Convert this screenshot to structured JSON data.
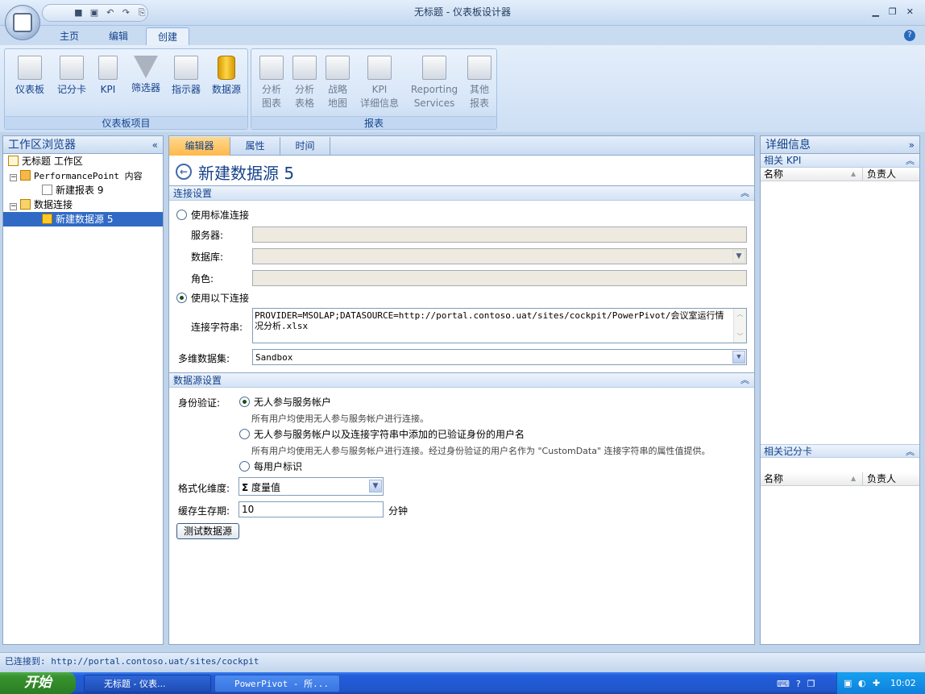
{
  "window": {
    "title": "无标题  -  仪表板设计器"
  },
  "ribbon_tabs": [
    "主页",
    "编辑",
    "创建"
  ],
  "ribbon": {
    "group1": {
      "label": "仪表板项目",
      "buttons": [
        "仪表板",
        "记分卡",
        "KPI",
        "筛选器",
        "指示器",
        "数据源"
      ]
    },
    "group2": {
      "label": "报表",
      "buttons": [
        [
          "分析",
          "图表"
        ],
        [
          "分析",
          "表格"
        ],
        [
          "战略",
          "地图"
        ],
        [
          "KPI",
          "详细信息"
        ],
        [
          "Reporting",
          "Services"
        ],
        [
          "其他",
          "报表"
        ]
      ]
    }
  },
  "left": {
    "title": "工作区浏览器",
    "workspace": "无标题 工作区",
    "ppcontent": "PerformancePoint 内容",
    "report": "新建报表 9",
    "dataconn": "数据连接",
    "datasource": "新建数据源 5"
  },
  "center": {
    "tabs": [
      "编辑器",
      "属性",
      "时间"
    ],
    "title": "新建数据源 5",
    "conn_section": "连接设置",
    "use_standard": "使用标准连接",
    "server_label": "服务器:",
    "database_label": "数据库:",
    "role_label": "角色:",
    "use_following": "使用以下连接",
    "connstr_label": "连接字符串:",
    "connstr": "PROVIDER=MSOLAP;DATASOURCE=http://portal.contoso.uat/sites/cockpit/PowerPivot/会议室运行情况分析.xlsx",
    "cube_label": "多维数据集:",
    "cube": "Sandbox",
    "ds_section": "数据源设置",
    "auth_label": "身份验证:",
    "auth1": "无人参与服务帐户",
    "auth1_desc": "所有用户均使用无人参与服务帐户进行连接。",
    "auth2": "无人参与服务帐户以及连接字符串中添加的已验证身份的用户名",
    "auth2_desc": "所有用户均使用无人参与服务帐户进行连接。经过身份验证的用户名作为 \"CustomData\" 连接字符串的属性值提供。",
    "auth3": "每用户标识",
    "fmt_label": "格式化维度:",
    "fmt_value": "度量值",
    "cache_label": "缓存生存期:",
    "cache_value": "10",
    "cache_unit": "分钟",
    "test_button": "测试数据源"
  },
  "right": {
    "title": "详细信息",
    "kpi_section": "相关 KPI",
    "sc_section": "相关记分卡",
    "col_name": "名称",
    "col_owner": "负责人"
  },
  "status": "已连接到:  http://portal.contoso.uat/sites/cockpit",
  "taskbar": {
    "start": "开始",
    "btn1": "无标题  -  仪表...",
    "btn2": "PowerPivot - 所...",
    "time": "10:02"
  }
}
